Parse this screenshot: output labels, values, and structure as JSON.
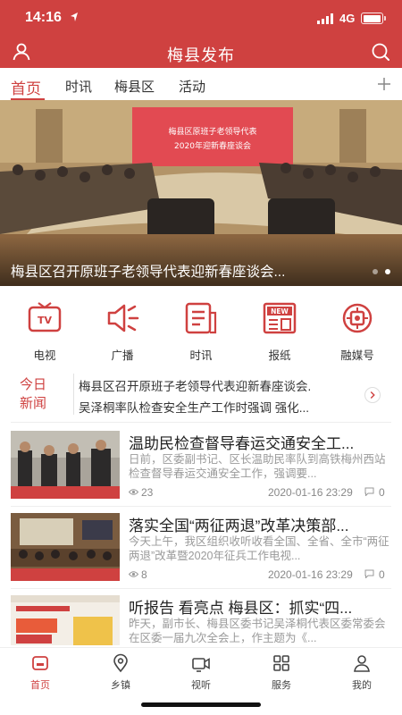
{
  "status_bar": {
    "time": "14:16",
    "network": "4G",
    "battery_level": 0.85
  },
  "header": {
    "title": "梅县发布",
    "user_icon": "user-icon",
    "search_icon": "search-icon"
  },
  "tabs": [
    {
      "label": "首页",
      "active": true
    },
    {
      "label": "时讯",
      "active": false
    },
    {
      "label": "梅县区",
      "active": false
    },
    {
      "label": "活动",
      "active": false
    }
  ],
  "hero": {
    "caption": "梅县区召开原班子老领导代表迎新春座谈会...",
    "banner_text": "梅县区原班子老领导代表 2020年迎新春座谈会",
    "slide_count": 2,
    "active_slide": 2
  },
  "grid": [
    {
      "label": "电视",
      "icon": "tv-icon"
    },
    {
      "label": "广播",
      "icon": "broadcast-icon"
    },
    {
      "label": "时讯",
      "icon": "news-doc-icon"
    },
    {
      "label": "报纸",
      "icon": "newspaper-icon"
    },
    {
      "label": "融媒号",
      "icon": "media-hub-icon"
    }
  ],
  "ticker": {
    "logo_top": "今日",
    "logo_bottom": "新闻",
    "lines": [
      "梅县区召开原班子老领导代表迎新春座谈会.",
      "吴泽桐率队检查安全生产工作时强调 强化..."
    ]
  },
  "news": [
    {
      "title": "温助民检查督导春运交通安全工...",
      "summary": "日前，区委副书记、区长温助民率队到高铁梅州西站检查督导春运交通安全工作，强调要...",
      "views": "23",
      "date": "2020-01-16 23:29",
      "comments": "0"
    },
    {
      "title": "落实全国“两征两退”改革决策部...",
      "summary": "今天上午，我区组织收听收看全国、全省、全市“两征两退”改革暨2020年征兵工作电视...",
      "views": "8",
      "date": "2020-01-16 23:29",
      "comments": "0"
    },
    {
      "title": "听报告 看亮点 梅县区：抓实“四...",
      "summary": "昨天，副市长、梅县区委书记吴泽桐代表区委常委会在区委一届九次全会上，作主题为《...",
      "views": "",
      "date": "",
      "comments": ""
    }
  ],
  "bottom_nav": [
    {
      "label": "首页",
      "icon": "home-icon",
      "active": true
    },
    {
      "label": "乡镇",
      "icon": "location-icon",
      "active": false
    },
    {
      "label": "视听",
      "icon": "video-icon",
      "active": false
    },
    {
      "label": "服务",
      "icon": "services-grid-icon",
      "active": false
    },
    {
      "label": "我的",
      "icon": "profile-icon",
      "active": false
    }
  ],
  "colors": {
    "brand": "#cf4140",
    "text": "#222222",
    "muted": "#9a9a9a"
  }
}
